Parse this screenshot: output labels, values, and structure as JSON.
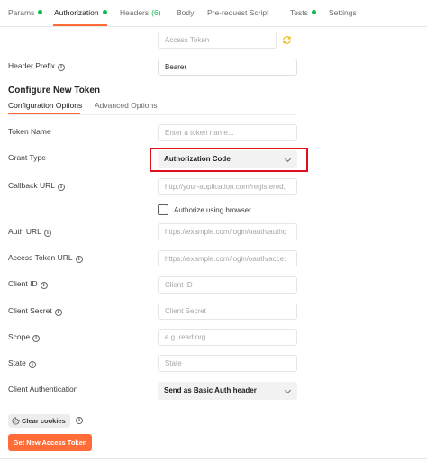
{
  "tabs": {
    "params": "Params",
    "authorization": "Authorization",
    "headers": "Headers",
    "headers_count": "(6)",
    "body": "Body",
    "prerequest": "Pre-request Script",
    "tests": "Tests",
    "settings": "Settings",
    "active": "Authorization",
    "dot_color": "#0cbb52"
  },
  "fields": {
    "access_token_placeholder": "Access Token",
    "header_prefix_label": "Header Prefix",
    "header_prefix_value": "Bearer"
  },
  "configure": {
    "title": "Configure New Token",
    "tab_options": "Configuration Options",
    "tab_advanced": "Advanced Options",
    "token_name_label": "Token Name",
    "token_name_placeholder": "Enter a token name...",
    "grant_type_label": "Grant Type",
    "grant_type_value": "Authorization Code",
    "callback_url_label": "Callback URL",
    "callback_url_placeholder": "http://your-application.com/registered,",
    "authorize_browser_label": "Authorize using browser",
    "auth_url_label": "Auth URL",
    "auth_url_placeholder": "https://example.com/login/oauth/authc",
    "access_token_url_label": "Access Token URL",
    "access_token_url_placeholder": "https://example.com/login/oauth/acce:",
    "client_id_label": "Client ID",
    "client_id_placeholder": "Client ID",
    "client_secret_label": "Client Secret",
    "client_secret_placeholder": "Client Secret",
    "scope_label": "Scope",
    "scope_placeholder": "e.g. read:org",
    "state_label": "State",
    "state_placeholder": "State",
    "client_auth_label": "Client Authentication",
    "client_auth_value": "Send as Basic Auth header"
  },
  "actions": {
    "clear_cookies": "Clear cookies",
    "get_token": "Get New Access Token"
  },
  "colors": {
    "accent": "#ff6c37",
    "highlight": "#e0101f",
    "sync_warning": "#f0b400"
  },
  "icons": {
    "info": "info-icon",
    "sync": "sync-icon",
    "cookie": "cookie-icon",
    "chevron": "chevron-down-icon"
  }
}
